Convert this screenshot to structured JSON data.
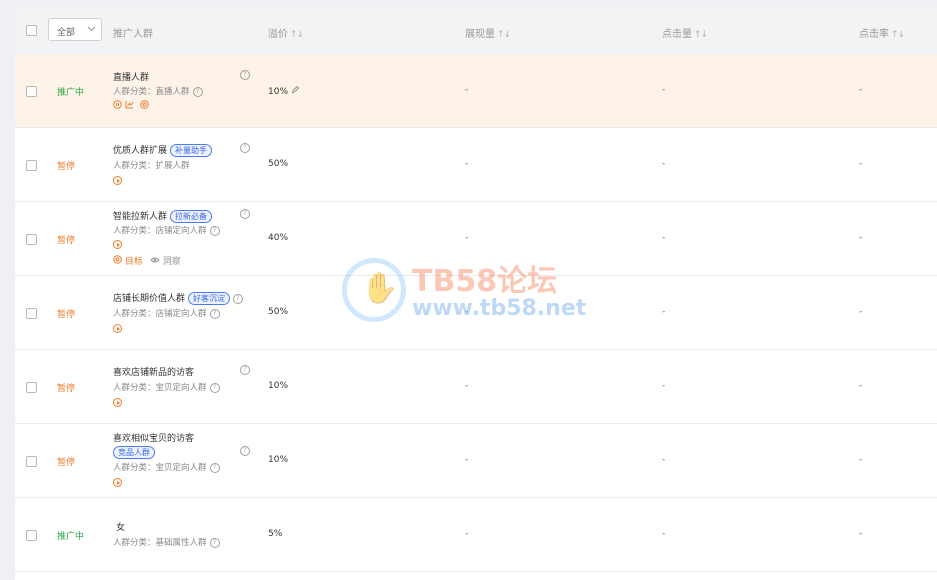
{
  "header": {
    "select_value": "全部",
    "col_audience": "推广人群",
    "col_premium": "溢价",
    "col_impressions": "展现量",
    "col_clicks": "点击量",
    "col_ctr": "点击率",
    "sort_glyph": "↑↓"
  },
  "common": {
    "cat_prefix": "人群分类：",
    "dash": "-",
    "help": "?"
  },
  "rows": [
    {
      "status": "推广中",
      "status_kind": "on",
      "name": "直播人群",
      "tag": "",
      "category": "直播人群",
      "premium": "10%"
    },
    {
      "status": "暂停",
      "status_kind": "off",
      "name": "优质人群扩展",
      "tag": "补量助手",
      "category": "扩展人群",
      "premium": "50%"
    },
    {
      "status": "暂停",
      "status_kind": "off",
      "name": "智能拉新人群",
      "tag": "拉新必备",
      "category": "店铺定向人群",
      "premium": "40%",
      "sub_target": "目标",
      "sub_insight": "洞察"
    },
    {
      "status": "暂停",
      "status_kind": "off",
      "name": "店铺长期价值人群",
      "tag": "好客沉淀",
      "category": "店铺定向人群",
      "premium": "50%"
    },
    {
      "status": "暂停",
      "status_kind": "off",
      "name": "喜欢店铺新品的访客",
      "tag": "",
      "category": "宝贝定向人群",
      "premium": "10%"
    },
    {
      "status": "暂停",
      "status_kind": "off",
      "name": "喜欢相似宝贝的访客",
      "tag": "竞品人群",
      "category": "宝贝定向人群",
      "premium": "10%"
    },
    {
      "status": "推广中",
      "status_kind": "on",
      "name": "女",
      "tag": "",
      "category": "基础属性人群",
      "premium": "5%"
    }
  ],
  "watermark": {
    "title": "TB58论坛",
    "url": "www.tb58.net"
  },
  "colors": {
    "on": "#2ba245",
    "off": "#f07b2a",
    "tag": "#3767e8",
    "highlight": "#fdf3e8"
  }
}
